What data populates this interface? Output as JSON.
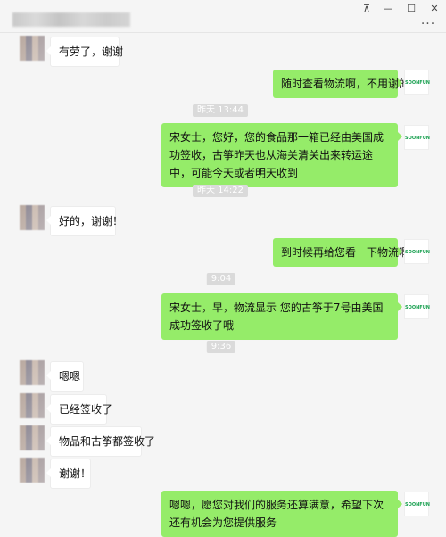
{
  "window": {
    "pin_icon": "pin-icon",
    "minimize_icon": "minimize-icon",
    "maximize_icon": "maximize-icon",
    "close_icon": "close-icon",
    "more_icon": "more-icon",
    "pin_glyph": "⊼",
    "minimize_glyph": "—",
    "maximize_glyph": "☐",
    "close_glyph": "✕",
    "more_glyph": "···"
  },
  "chat": {
    "seller_avatar_text": "SOONFUN",
    "messages": [
      {
        "side": "in",
        "text": "有劳了，谢谢"
      },
      {
        "side": "out",
        "text": "随时查看物流啊，不用谢的"
      },
      {
        "type": "time",
        "text": "昨天 13:44"
      },
      {
        "side": "out",
        "text": "宋女士，您好，您的食品那一箱已经由美国成功签收，古筝昨天也从海关清关出来转运途中，可能今天或者明天收到"
      },
      {
        "type": "time",
        "text": "昨天 14:22"
      },
      {
        "side": "in",
        "text": "好的，谢谢！"
      },
      {
        "side": "out",
        "text": "到时候再给您看一下物流啊"
      },
      {
        "type": "time",
        "text": "9:04"
      },
      {
        "side": "out",
        "text": "宋女士，早，物流显示 您的古筝于7号由美国成功签收了哦"
      },
      {
        "type": "time",
        "text": "9:36"
      },
      {
        "side": "in",
        "text": "嗯嗯"
      },
      {
        "side": "in",
        "text": "已经签收了"
      },
      {
        "side": "in",
        "text": "物品和古筝都签收了"
      },
      {
        "side": "in",
        "text": "谢谢！"
      },
      {
        "side": "out",
        "text": "嗯嗯，愿您对我们的服务还算满意，希望下次还有机会为您提供服务"
      }
    ]
  },
  "colors": {
    "outgoing_bubble": "#95ec69",
    "incoming_bubble": "#ffffff",
    "background": "#f5f5f5",
    "timestamp_bg": "#dadada",
    "logo_green": "#19a050"
  }
}
